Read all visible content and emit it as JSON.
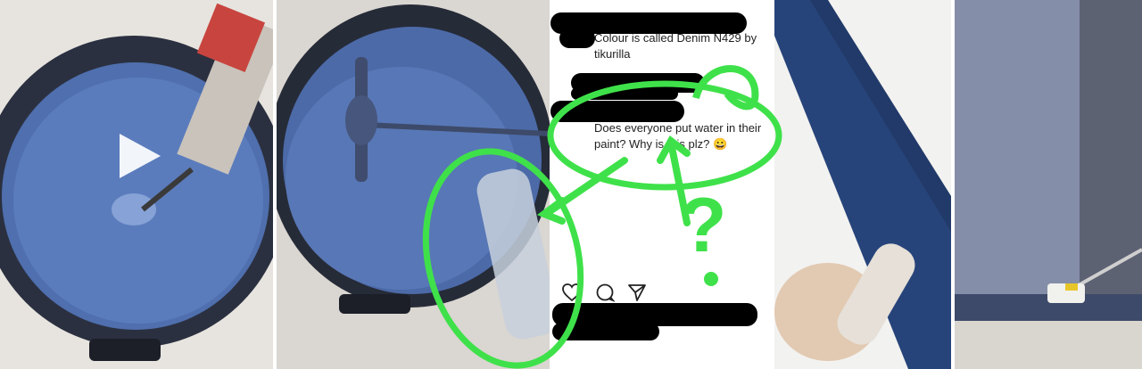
{
  "comments": [
    {
      "text": "Colour is called Denim N429 by tikurilla"
    },
    {
      "text": "Does everyone put water in their paint? Why is this plz? 😀"
    }
  ],
  "annotation": {
    "question_mark": "?"
  },
  "icons": {
    "play": "play-icon",
    "like": "heart-icon",
    "comment": "comment-icon",
    "share": "share-icon"
  },
  "colors": {
    "paint": "#5877b6",
    "annotation_green": "#3fe14a",
    "bucket": "#2c3140"
  }
}
